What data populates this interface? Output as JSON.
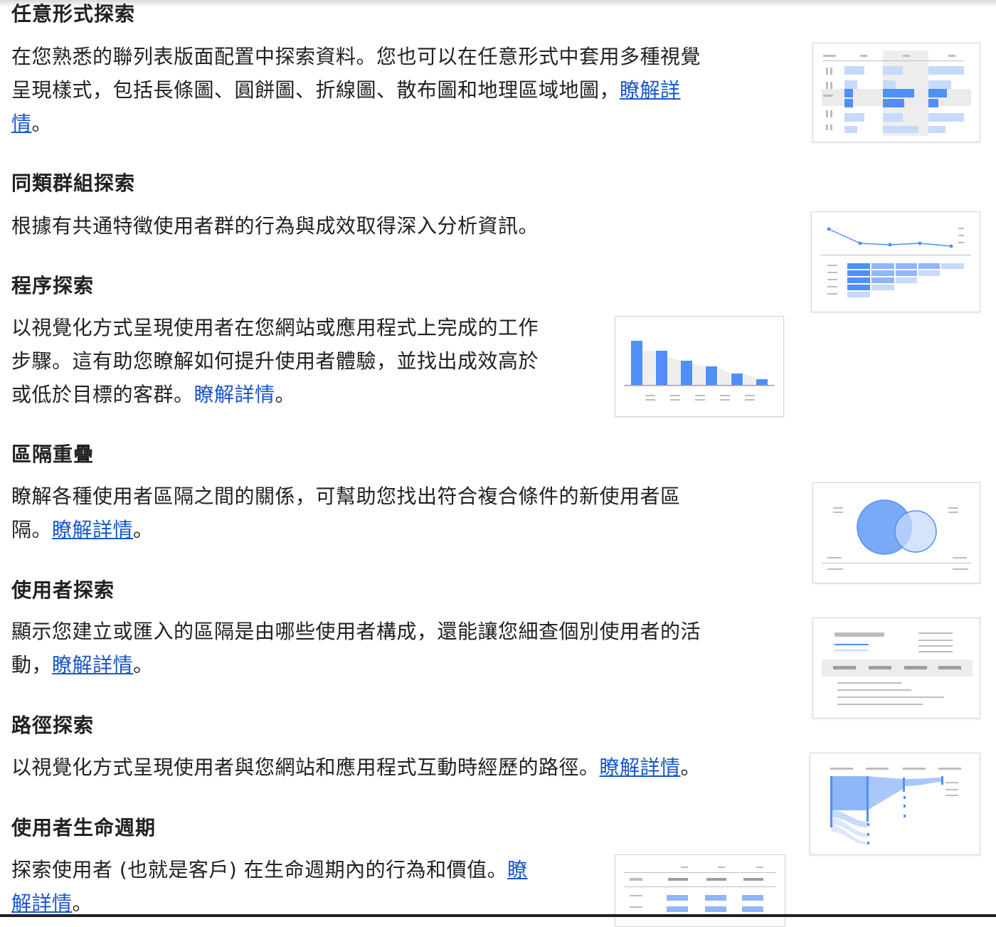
{
  "sections": [
    {
      "title": "任意形式探索",
      "lines": [
        "在您熟悉的聯列表版面配置中探索資料。您也可以在任意形式中套用多種視覺",
        "呈現樣式，包括長條圖、圓餅圖、折線圖、散布圖和地理區域地圖，"
      ],
      "link_parts": [
        "瞭解詳",
        "情"
      ],
      "suffix": "。",
      "thumbnail_icon": "freeform-table-thumbnail"
    },
    {
      "title": "同類群組探索",
      "lines": [
        "根據有共通特徵使用者群的行為與成效取得深入分析資訊。"
      ],
      "thumbnail_icon": "cohort-chart-thumbnail"
    },
    {
      "title": "程序探索",
      "lines": [
        "以視覺化方式呈現使用者在您網站或應用程式上完成的工作",
        "步驟。這有助您瞭解如何提升使用者體驗，並找出成效高於",
        "或低於目標的客群。"
      ],
      "link": "瞭解詳情",
      "suffix": "。",
      "thumbnail_icon": "funnel-bar-thumbnail"
    },
    {
      "title": "區隔重疊",
      "lines": [
        "瞭解各種使用者區隔之間的關係，可幫助您找出符合複合條件的新使用者區",
        "隔。"
      ],
      "link": "瞭解詳情",
      "suffix": "。",
      "thumbnail_icon": "venn-diagram-thumbnail"
    },
    {
      "title": "使用者探索",
      "lines": [
        "顯示您建立或匯入的區隔是由哪些使用者構成，還能讓您細查個別使用者的活",
        "動，"
      ],
      "link": "瞭解詳情",
      "suffix": "。",
      "thumbnail_icon": "user-detail-thumbnail"
    },
    {
      "title": "路徑探索",
      "lines": [
        "以視覺化方式呈現使用者與您網站和應用程式互動時經歷的路徑。"
      ],
      "link": "瞭解詳情",
      "suffix": "。",
      "thumbnail_icon": "path-sankey-thumbnail"
    },
    {
      "title": "使用者生命週期",
      "lines": [
        "探索使用者 (也就是客戶) 在生命週期內的行為和價值。"
      ],
      "link_parts": [
        "瞭",
        "解詳情"
      ],
      "suffix": "。",
      "thumbnail_icon": "lifetime-table-thumbnail"
    }
  ],
  "colors": {
    "link": "#1a57c9",
    "accent_blue": "#4f8ff7",
    "light_blue": "#c7dafc",
    "gray_line": "#bdbdbd"
  }
}
